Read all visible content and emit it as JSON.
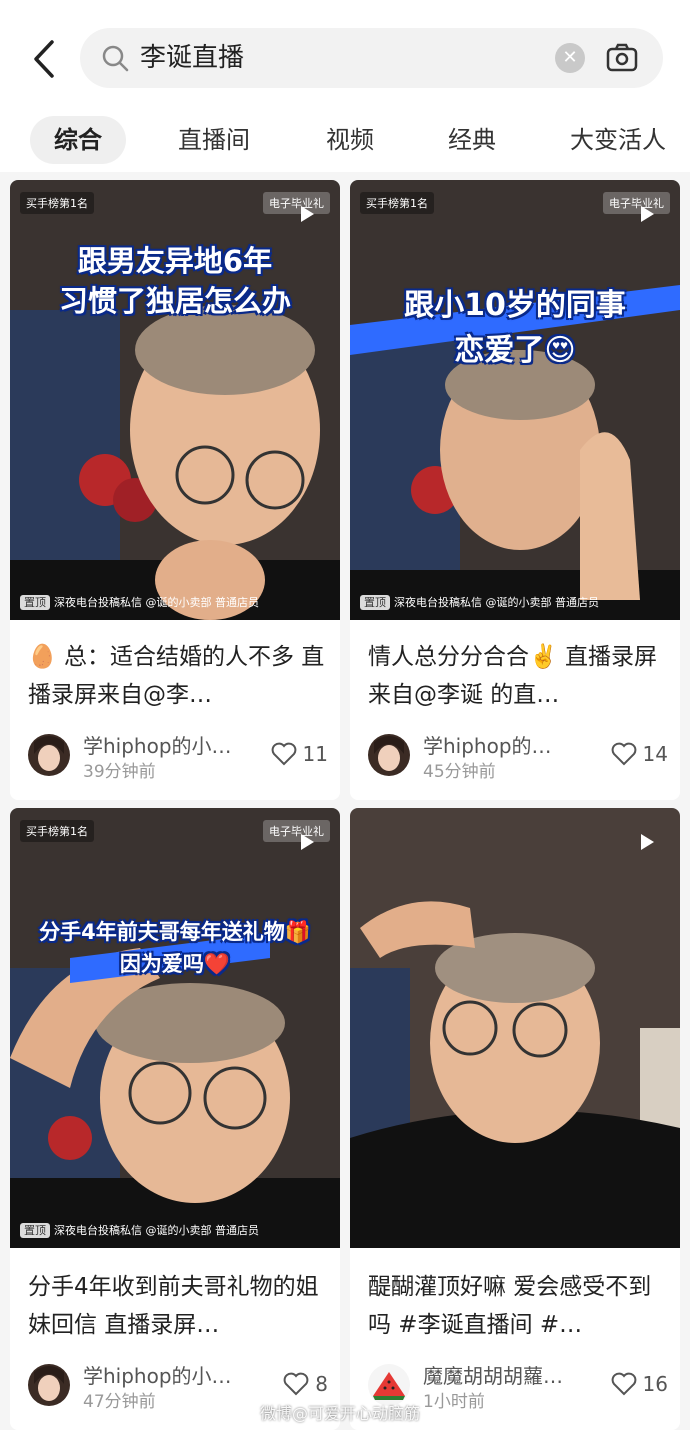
{
  "search": {
    "query": "李诞直播"
  },
  "tabs": [
    "综合",
    "直播间",
    "视频",
    "经典",
    "大变活人"
  ],
  "cards": [
    {
      "overlay_line1": "跟男友异地6年",
      "overlay_line2": "习惯了独居怎么办",
      "badge_top": "买手榜第1名",
      "badge_right": "电子毕业礼",
      "caption_tag": "置顶",
      "caption": "深夜电台投稿私信 @诞的小卖部 普通店员",
      "title": "🥚 总：适合结婚的人不多 直播录屏来自@李…",
      "author": "学hiphop的小…",
      "time": "39分钟前",
      "likes": "11"
    },
    {
      "overlay_line1": "跟小10岁的同事",
      "overlay_line2": "恋爱了😍",
      "badge_top": "买手榜第1名",
      "badge_right": "电子毕业礼",
      "caption_tag": "置顶",
      "caption": "深夜电台投稿私信 @诞的小卖部 普通店员",
      "title": "情人总分分合合✌️ 直播录屏来自@李诞 的直…",
      "author": "学hiphop的…",
      "time": "45分钟前",
      "likes": "14"
    },
    {
      "overlay_line1": "分手4年前夫哥每年送礼物🎁",
      "overlay_line2": "因为爱吗❤️",
      "badge_top": "买手榜第1名",
      "badge_right": "电子毕业礼",
      "caption_tag": "置顶",
      "caption": "深夜电台投稿私信 @诞的小卖部 普通店员",
      "title": "分手4年收到前夫哥礼物的姐妹回信 直播录屏…",
      "author": "学hiphop的小…",
      "time": "47分钟前",
      "likes": "8"
    },
    {
      "overlay_line1": "",
      "overlay_line2": "",
      "badge_top": "",
      "badge_right": "",
      "caption_tag": "",
      "caption": "",
      "title": "醍醐灌顶好嘛 爱会感受不到吗 #李诞直播间 #…",
      "author": "魔魔胡胡胡蘿…",
      "time": "1小时前",
      "likes": "16"
    }
  ],
  "watermark": "微博@可爱开心动脑筋",
  "colors": {
    "accent": "#ff2442",
    "overlay_stroke": "#0a2a8a",
    "blue_stripe": "#2f6bff"
  }
}
